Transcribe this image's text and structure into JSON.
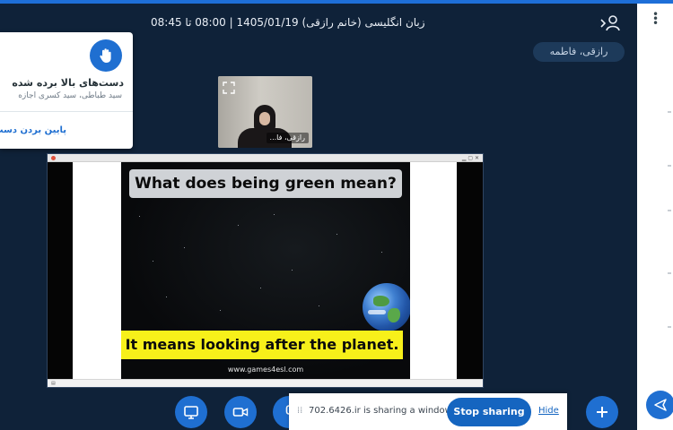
{
  "header": {
    "title": "زبان انگلیسی (خانم رازقی) 1405/01/19 | 08:00 تا 08:45",
    "presenter_name": "رازقی، فاطمه"
  },
  "raise_hands_card": {
    "title": "دست‌های بالا برده شده",
    "subtitle": "سید طباطی، سید کسری اجازه",
    "action": "پایین بردن دست"
  },
  "webcam": {
    "label": "رازقی، فا..."
  },
  "slide": {
    "question": "What does being green mean?",
    "answer": "It means looking after the planet.",
    "website": "www.games4esl.com"
  },
  "share_bar": {
    "message": "702.6426.ir is sharing a window.",
    "stop_label": "Stop sharing",
    "hide_label": "Hide"
  },
  "controls": {
    "icons": [
      "screen-share-icon",
      "video-icon",
      "plus-icon"
    ]
  },
  "colors": {
    "background": "#0f2239",
    "accent": "#1f6fd1",
    "highlight": "#f7f01a"
  }
}
